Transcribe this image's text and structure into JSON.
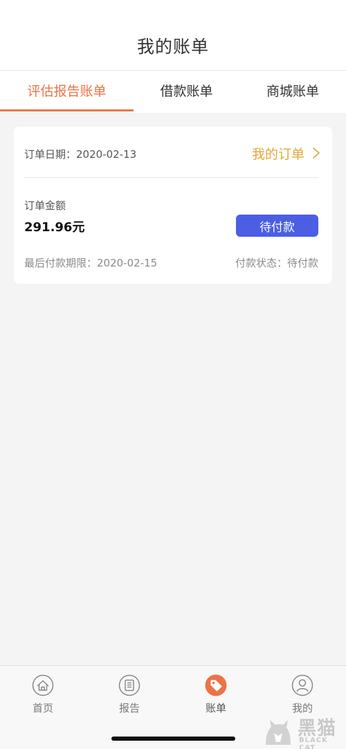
{
  "header": {
    "title": "我的账单"
  },
  "tabs": [
    {
      "label": "评估报告账单",
      "active": true
    },
    {
      "label": "借款账单",
      "active": false
    },
    {
      "label": "商城账单",
      "active": false
    }
  ],
  "order": {
    "date_text": "订单日期：2020-02-13",
    "link_label": "我的订单",
    "amount_label": "订单金额",
    "amount_value": "291.96元",
    "pay_button": "待付款",
    "deadline_text": "最后付款期限：2020-02-15",
    "status_text": "付款状态：待付款"
  },
  "tabbar": [
    {
      "label": "首页",
      "icon": "home-icon",
      "active": false
    },
    {
      "label": "报告",
      "icon": "report-icon",
      "active": false
    },
    {
      "label": "账单",
      "icon": "bill-tag-icon",
      "active": true
    },
    {
      "label": "我的",
      "icon": "user-icon",
      "active": false
    }
  ],
  "watermark": {
    "cn": "黑猫",
    "en": "BLACK CAT"
  },
  "colors": {
    "accent": "#ec7345",
    "link": "#e0a83a",
    "button": "#4b5ee4",
    "background": "#f4f4f4"
  }
}
